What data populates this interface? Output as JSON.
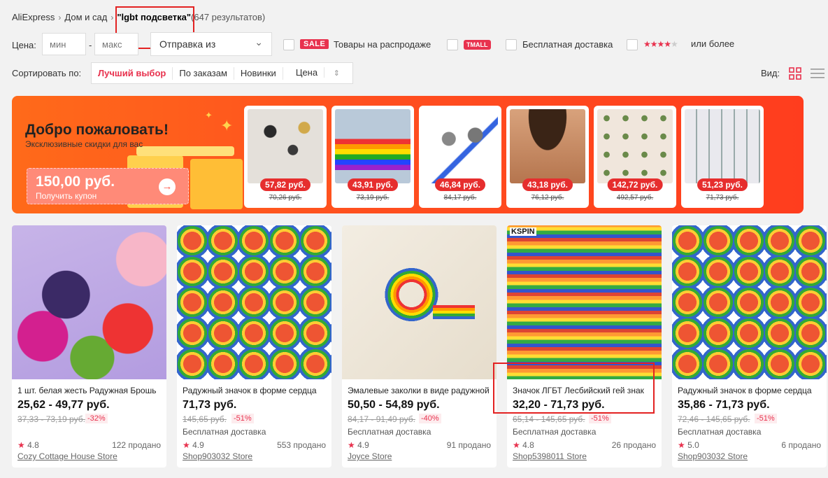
{
  "breadcrumb": {
    "home": "AliExpress",
    "category": "Дом и сад",
    "query": "\"lgbt подсветка\"",
    "count": "(647 результатов)"
  },
  "filters": {
    "price_label": "Цена:",
    "min_placeholder": "мин",
    "dash": "-",
    "max_placeholder": "макс",
    "ship_from": "Отправка из",
    "sale_badge": "SALE",
    "sale_label": "Товары на распродаже",
    "tmall_badge": "TMALL",
    "free_shipping": "Бесплатная доставка",
    "stars": "★★★★",
    "star_empty": "★",
    "rating_label": "или более"
  },
  "sort": {
    "label": "Сортировать по:",
    "options": [
      "Лучший выбор",
      "По заказам",
      "Новинки",
      "Цена"
    ],
    "price_arrow": "⇕",
    "view_label": "Вид:"
  },
  "banner": {
    "title": "Добро пожаловать!",
    "subtitle": "Эксклюзивные скидки для вас",
    "coupon_amount": "150,00 руб.",
    "coupon_action": "Получить купон",
    "items": [
      {
        "price": "57,82 руб.",
        "old": "70,26 руб."
      },
      {
        "price": "43,91 руб.",
        "old": "73,19 руб."
      },
      {
        "price": "46,84 руб.",
        "old": "84,17 руб."
      },
      {
        "price": "43,18 руб.",
        "old": "76,12 руб."
      },
      {
        "price": "142,72 руб.",
        "old": "492,57 руб."
      },
      {
        "price": "51,23 руб.",
        "old": "71,73 руб."
      }
    ]
  },
  "products": [
    {
      "title": "1 шт. белая жесть Радужная Брошь",
      "price": "25,62 - 49,77 руб.",
      "old": "37,33 - 73,19 руб.",
      "discount": "-32%",
      "shipping": "",
      "rating": "4.8",
      "sold": "122 продано",
      "store": "Cozy Cottage House Store"
    },
    {
      "title": "Радужный значок в форме сердца",
      "price": "71,73 руб.",
      "old": "145,65 руб.",
      "discount": "-51%",
      "shipping": "Бесплатная доставка",
      "rating": "4.9",
      "sold": "553 продано",
      "store": "Shop903032 Store"
    },
    {
      "title": "Эмалевые заколки в виде радужной",
      "price": "50,50 - 54,89 руб.",
      "old": "84,17 - 91,49 руб.",
      "discount": "-40%",
      "shipping": "Бесплатная доставка",
      "rating": "4.9",
      "sold": "91 продано",
      "store": "Joyce Store"
    },
    {
      "title": "Значок ЛГБТ Лесбийский гей знак",
      "price": "32,20 - 71,73 руб.",
      "old": "65,14 - 145,65 руб.",
      "discount": "-51%",
      "shipping": "Бесплатная доставка",
      "rating": "4.8",
      "sold": "26 продано",
      "store": "Shop5398011 Store",
      "brand": "KSPIN"
    },
    {
      "title": "Радужный значок в форме сердца",
      "price": "35,86 - 71,73 руб.",
      "old": "72,46 - 145,65 руб.",
      "discount": "-51%",
      "shipping": "Бесплатная доставка",
      "rating": "5.0",
      "sold": "6 продано",
      "store": "Shop903032 Store"
    }
  ],
  "icons": {
    "arrow": "→",
    "chevron": "⌄",
    "star": "★"
  },
  "colors": {
    "accent": "#e8324e",
    "banner": "#ff4f1f",
    "highlight": "#e32222"
  }
}
